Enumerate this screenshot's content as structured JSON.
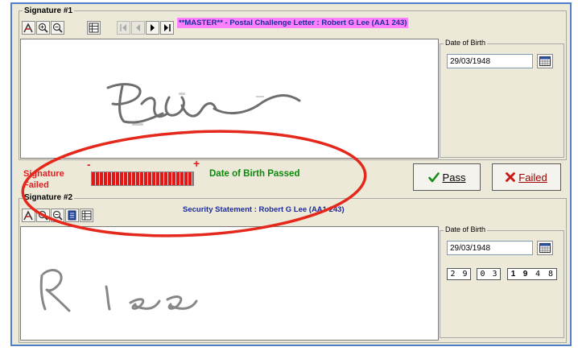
{
  "signature1": {
    "group_label": "Signature #1",
    "document_title": "**MASTER** - Postal Challenge Letter : Robert G Lee (AA1 243)",
    "dob_label": "Date of Birth",
    "dob_value": "29/03/1948"
  },
  "verification": {
    "signature_status": "Signature\nFailed",
    "scale_minus": "-",
    "scale_plus": "+",
    "meter_level": 1.0,
    "dob_status": "Date of Birth Passed",
    "pass_label": "Pass",
    "fail_label": "Failed"
  },
  "signature2": {
    "group_label": "Signature #2",
    "document_title": "Security Statement : Robert G Lee (AA1 243)",
    "dob_label": "Date of Birth",
    "dob_value": "29/03/1948",
    "dob_digits": [
      "2",
      "9",
      "0",
      "3",
      "1",
      "9",
      "4",
      "8"
    ]
  },
  "colors": {
    "frame_border": "#4f7fc9",
    "title_highlight": "#ff80ff",
    "title_blue": "#1c2c9a",
    "failed_red": "#e02020",
    "passed_green": "#0a8a0a",
    "annotation_ellipse": "#e4281c"
  },
  "icons": [
    "signature-tool-icon",
    "zoom-in-icon",
    "zoom-out-icon",
    "grid-view-icon",
    "first-page-icon",
    "previous-page-icon",
    "next-page-icon",
    "last-page-icon",
    "calendar-icon",
    "checkmark-icon",
    "cross-icon",
    "page-icon"
  ]
}
